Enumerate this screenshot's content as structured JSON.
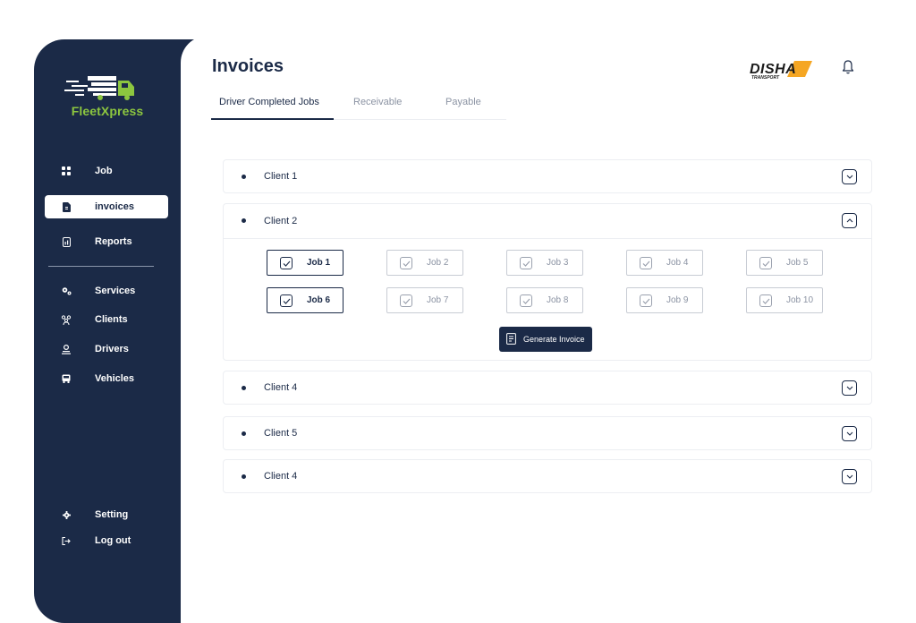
{
  "brand": {
    "name": "FleetXpress",
    "accent": "#8cc63f",
    "sidebar_bg": "#1b2a47"
  },
  "sidebar": {
    "items": [
      {
        "label": "Job",
        "icon": "grid-icon"
      },
      {
        "label": "invoices",
        "icon": "invoice-icon",
        "active": true
      },
      {
        "label": "Reports",
        "icon": "report-icon"
      },
      {
        "label": "Services",
        "icon": "gears-icon"
      },
      {
        "label": "Clients",
        "icon": "clients-icon"
      },
      {
        "label": "Drivers",
        "icon": "driver-icon"
      },
      {
        "label": "Vehicles",
        "icon": "bus-icon"
      }
    ],
    "bottom": [
      {
        "label": "Setting",
        "icon": "gear-icon"
      },
      {
        "label": "Log out",
        "icon": "logout-icon"
      }
    ]
  },
  "header": {
    "title": "Invoices",
    "tabs": [
      "Driver Completed Jobs",
      "Receivable",
      "Payable"
    ],
    "active_tab": 0,
    "company_logo": {
      "text": "DISHA",
      "subtext": "TRANSPORT"
    }
  },
  "clients": [
    {
      "name": "Client 1",
      "expanded": false
    },
    {
      "name": "Client 2",
      "expanded": true,
      "jobs": [
        {
          "label": "Job 1",
          "selected": true
        },
        {
          "label": "Job 2",
          "selected": false
        },
        {
          "label": "Job 3",
          "selected": false
        },
        {
          "label": "Job 4",
          "selected": false
        },
        {
          "label": "Job 5",
          "selected": false
        },
        {
          "label": "Job 6",
          "selected": true
        },
        {
          "label": "Job 7",
          "selected": false
        },
        {
          "label": "Job 8",
          "selected": false
        },
        {
          "label": "Job 9",
          "selected": false
        },
        {
          "label": "Job 10",
          "selected": false
        }
      ],
      "action_label": "Generate Invoice"
    },
    {
      "name": "Client 4",
      "expanded": false
    },
    {
      "name": "Client 5",
      "expanded": false
    },
    {
      "name": "Client 4",
      "expanded": false
    }
  ]
}
